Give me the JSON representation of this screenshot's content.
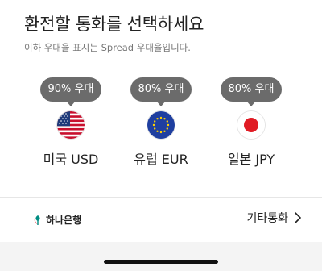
{
  "header": {
    "title": "환전할 통화를 선택하세요",
    "subtitle": "이하 우대율 표시는 Spread 우대율입니다."
  },
  "currencies": [
    {
      "discount": "90% 우대",
      "label": "미국 USD",
      "flag_icon": "us-flag-icon"
    },
    {
      "discount": "80% 우대",
      "label": "유럽 EUR",
      "flag_icon": "eu-flag-icon"
    },
    {
      "discount": "80% 우대",
      "label": "일본 JPY",
      "flag_icon": "japan-flag-icon"
    }
  ],
  "footer": {
    "bank_name": "하나은행",
    "other_currency_label": "기타통화"
  },
  "colors": {
    "bubble": "#6b6b6b",
    "divider": "#e6e6e6",
    "hana_green": "#008c82"
  }
}
